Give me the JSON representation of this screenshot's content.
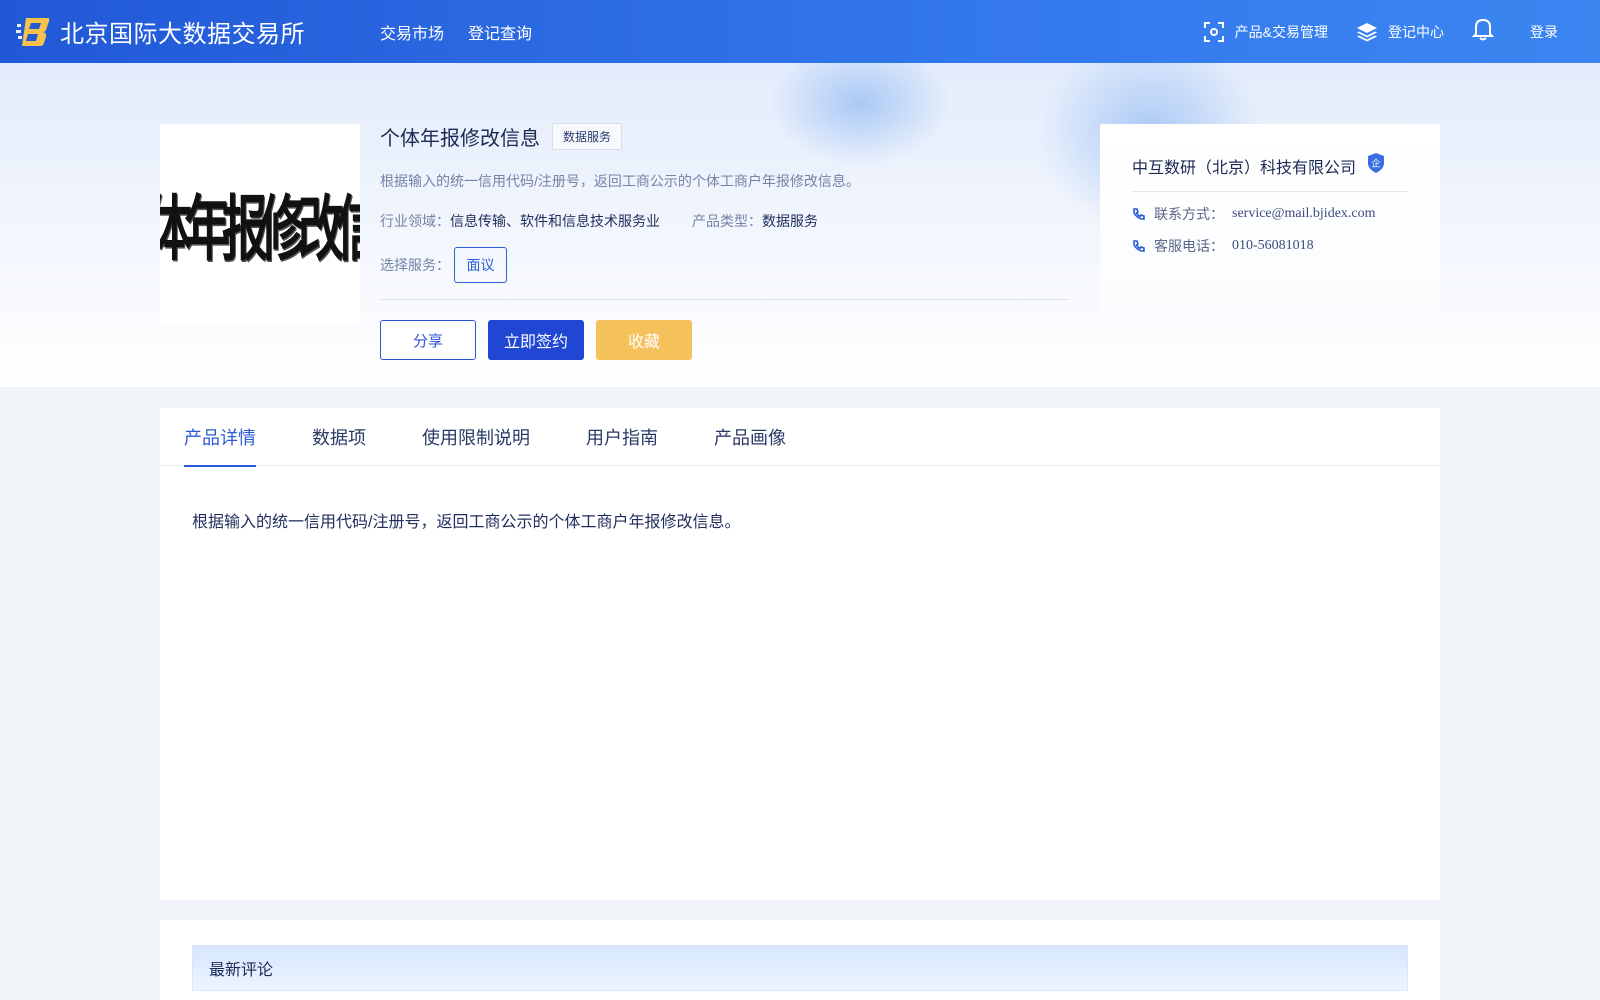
{
  "header": {
    "brand_name": "北京国际大数据交易所",
    "nav": [
      "交易市场",
      "登记查询"
    ],
    "product_mgmt": "产品&交易管理",
    "register_center": "登记中心",
    "login": "登录"
  },
  "product": {
    "thumb_text": "个体年报修改信息",
    "title": "个体年报修改信息",
    "tag": "数据服务",
    "description": "根据输入的统一信用代码/注册号，返回工商公示的个体工商户年报修改信息。",
    "industry_label": "行业领域：",
    "industry_value": "信息传输、软件和信息技术服务业",
    "type_label": "产品类型：",
    "type_value": "数据服务",
    "service_label": "选择服务：",
    "service_option": "面议",
    "share_label": "分享",
    "sign_label": "立即签约",
    "favorite_label": "收藏"
  },
  "company": {
    "name": "中互数研（北京）科技有限公司",
    "badge": "企",
    "contact_label": "联系方式：",
    "contact_value": "service@mail.bjidex.com",
    "phone_label": "客服电话：",
    "phone_value": "010-56081018"
  },
  "tabs": [
    {
      "label": "产品详情",
      "active": true
    },
    {
      "label": "数据项",
      "active": false
    },
    {
      "label": "使用限制说明",
      "active": false
    },
    {
      "label": "用户指南",
      "active": false
    },
    {
      "label": "产品画像",
      "active": false
    }
  ],
  "detail_text": "根据输入的统一信用代码/注册号，返回工商公示的个体工商户年报修改信息。",
  "comments": {
    "title": "最新评论"
  },
  "colors": {
    "header_gradient_start": "#2158d6",
    "header_gradient_end": "#3b86f1",
    "primary": "#1f47d3",
    "accent_link": "#2a5bd7",
    "favorite": "#f5c15b"
  }
}
